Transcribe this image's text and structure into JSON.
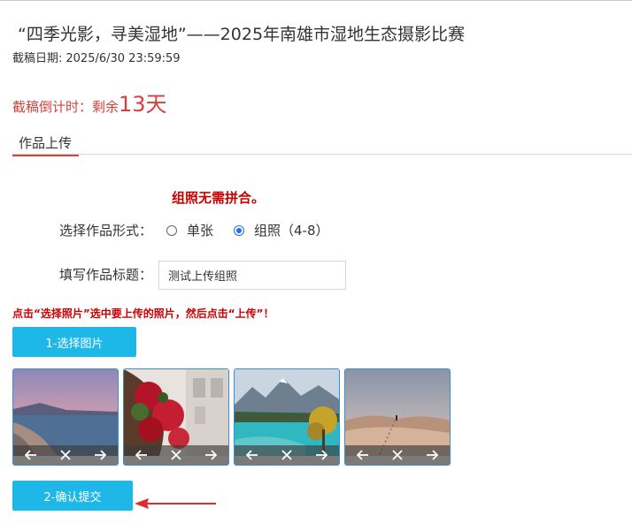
{
  "contest": {
    "title": "“四季光影，寻美湿地”——2025年南雄市湿地生态摄影比赛",
    "deadline_label": "截稿日期:",
    "deadline_value": "2025/6/30 23:59:59",
    "countdown_label": "截稿倒计时：剩余",
    "countdown_value": "13天"
  },
  "tabs": [
    {
      "label": "作品上传",
      "active": true
    }
  ],
  "form": {
    "group_notice": "组照无需拼合。",
    "format_label": "选择作品形式：",
    "format_options": [
      {
        "label": "单张",
        "checked": false
      },
      {
        "label": "组照（4-8）",
        "checked": true
      }
    ],
    "title_label": "填写作品标题：",
    "title_value": "测试上传组照",
    "instruction": "点击“选择照片”选中要上传的照片，然后点击“上传”！",
    "select_button": "1-选择图片",
    "submit_button": "2-确认提交"
  },
  "photos": [
    {
      "subject": "lakeside-rocks-dusk"
    },
    {
      "subject": "red-flowers-by-window"
    },
    {
      "subject": "mountain-lake-autumn-tree"
    },
    {
      "subject": "desert-dunes-footprints"
    }
  ],
  "photo_controls": [
    "arrow-left-icon",
    "close-icon",
    "arrow-right-icon"
  ],
  "colors": {
    "accent_red": "#d0433a",
    "alert_red": "#cc0000",
    "button_blue": "#1eb8e8",
    "thumb_border": "#3b8fd1"
  }
}
